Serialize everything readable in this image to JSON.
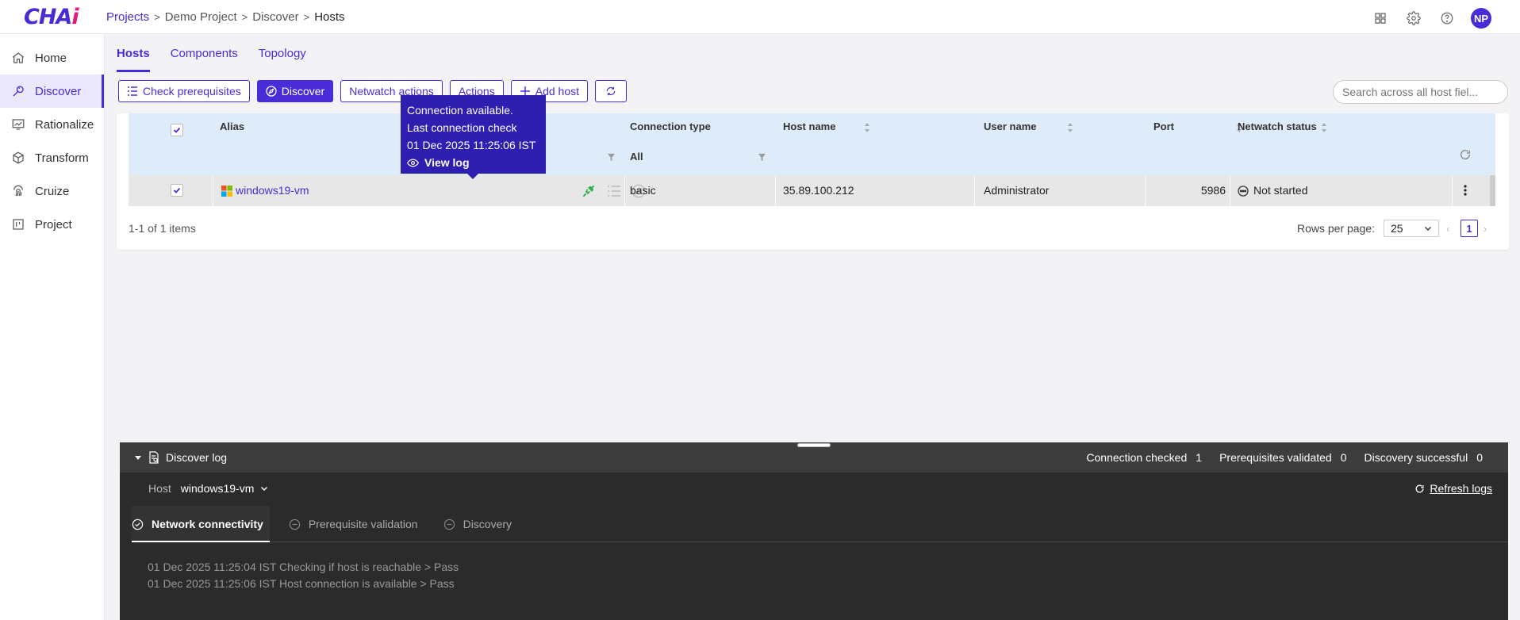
{
  "app": {
    "logo_main": "CHA",
    "logo_accent": "i",
    "avatar_initials": "NP"
  },
  "breadcrumb": [
    "Projects",
    "Demo Project",
    "Discover",
    "Hosts"
  ],
  "sidebar": {
    "items": [
      {
        "label": "Home",
        "icon": "home-icon"
      },
      {
        "label": "Discover",
        "icon": "discover-icon",
        "active": true
      },
      {
        "label": "Rationalize",
        "icon": "rationalize-icon"
      },
      {
        "label": "Transform",
        "icon": "cube-icon"
      },
      {
        "label": "Cruize",
        "icon": "fingerprint-icon"
      },
      {
        "label": "Project",
        "icon": "board-icon"
      }
    ]
  },
  "tabs": [
    {
      "label": "Hosts",
      "active": true
    },
    {
      "label": "Components"
    },
    {
      "label": "Topology"
    }
  ],
  "toolbar": {
    "check_prereq": "Check prerequisites",
    "discover": "Discover",
    "netwatch": "Netwatch actions",
    "actions": "Actions",
    "add_host": "Add host"
  },
  "search": {
    "placeholder": "Search across all host fiel..."
  },
  "table": {
    "columns": {
      "alias": "Alias",
      "connection_type": "Connection type",
      "host_name": "Host name",
      "user_name": "User name",
      "port": "Port",
      "netwatch_status": "Netwatch status"
    },
    "filters": {
      "connection_type": "All"
    },
    "rows": [
      {
        "alias": "windows19-vm",
        "connection_type": "basic",
        "host_name": "35.89.100.212",
        "user_name": "Administrator",
        "port": "5986",
        "netwatch_status": "Not started"
      }
    ],
    "count_text": "1-1 of 1 items",
    "rows_per_page_label": "Rows per page:",
    "rows_per_page": "25",
    "current_page": "1"
  },
  "tooltip": {
    "line1": "Connection available.",
    "line2": "Last connection check",
    "line3": "01 Dec 2025 11:25:06 IST",
    "view_log": "View log"
  },
  "log": {
    "title": "Discover log",
    "stats": [
      {
        "label": "Connection checked",
        "value": "1"
      },
      {
        "label": "Prerequisites validated",
        "value": "0"
      },
      {
        "label": "Discovery successful",
        "value": "0"
      }
    ],
    "host_label": "Host",
    "host_value": "windows19-vm",
    "refresh": "Refresh logs",
    "tabs": [
      {
        "label": "Network connectivity",
        "active": true
      },
      {
        "label": "Prerequisite validation"
      },
      {
        "label": "Discovery"
      }
    ],
    "lines": [
      "01 Dec 2025 11:25:04 IST Checking if host is reachable > Pass",
      "01 Dec 2025 11:25:06 IST Host connection is available > Pass"
    ]
  },
  "colors": {
    "accent": "#4a2bd8",
    "logo_accent": "#e4197d",
    "connection_ok": "#2eae4e"
  }
}
